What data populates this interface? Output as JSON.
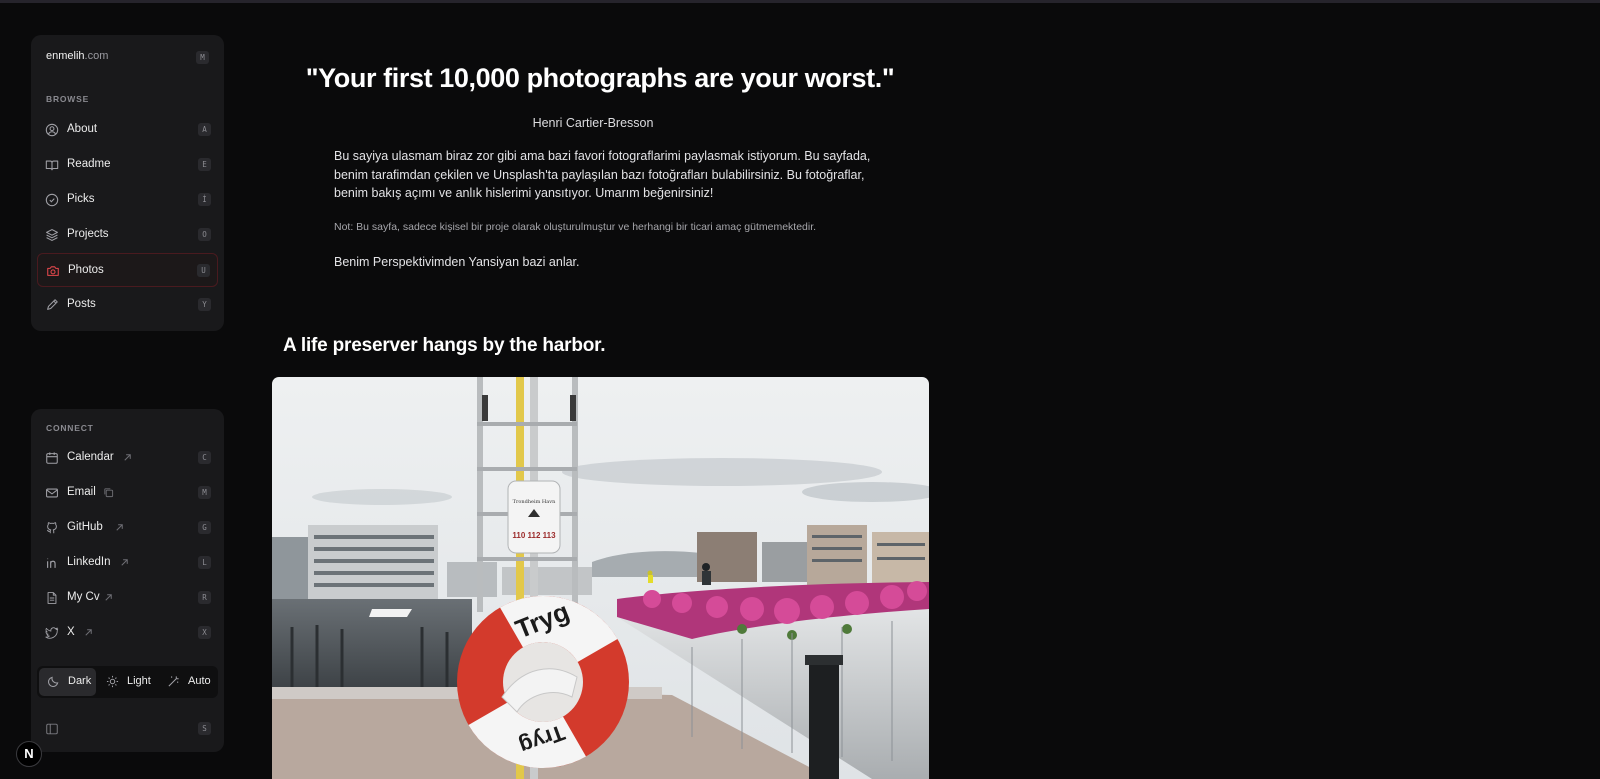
{
  "site": {
    "name": "enmelih",
    "tld": ".com",
    "key": "M"
  },
  "browse": {
    "label": "BROWSE",
    "items": [
      {
        "label": "About",
        "key": "A",
        "icon": "user-circle-icon"
      },
      {
        "label": "Readme",
        "key": "E",
        "icon": "book-open-icon"
      },
      {
        "label": "Picks",
        "key": "İ",
        "icon": "check-circle-icon"
      },
      {
        "label": "Projects",
        "key": "O",
        "icon": "layers-icon"
      },
      {
        "label": "Photos",
        "key": "U",
        "icon": "camera-icon",
        "active": true
      },
      {
        "label": "Posts",
        "key": "Y",
        "icon": "pencil-icon"
      }
    ]
  },
  "connect": {
    "label": "CONNECT",
    "items": [
      {
        "label": "Calendar",
        "key": "C",
        "icon": "calendar-icon",
        "trailing": "external-link-icon"
      },
      {
        "label": "Email",
        "key": "M",
        "icon": "mail-icon",
        "trailing": "copy-icon"
      },
      {
        "label": "GitHub",
        "key": "G",
        "icon": "github-icon",
        "trailing": "external-link-icon"
      },
      {
        "label": "LinkedIn",
        "key": "L",
        "icon": "linkedin-icon",
        "trailing": "external-link-icon"
      },
      {
        "label": "My Cv",
        "key": "R",
        "icon": "file-icon",
        "trailing": "external-link-icon"
      },
      {
        "label": "X",
        "key": "X",
        "icon": "twitter-icon",
        "trailing": "external-link-icon"
      }
    ],
    "theme": {
      "dark": "Dark",
      "light": "Light",
      "auto": "Auto",
      "selected": "Dark"
    },
    "sidebar_toggle_key": "S"
  },
  "content": {
    "quote": "\"Your first 10,000 photographs are your worst.\"",
    "author": "Henri Cartier-Bresson",
    "paragraph": "Bu sayiya ulasmam biraz zor gibi ama bazi favori fotograflarimi paylasmak istiyorum. Bu sayfada, benim tarafimdan çekilen ve Unsplash'ta paylaşılan bazı fotoğrafları bulabilirsiniz. Bu fotoğraflar, benim bakış açımı ve anlık hislerimi yansıtıyor. Umarım beğenirsiniz!",
    "note": "Not: Bu sayfa, sadece kişisel bir proje olarak oluşturulmuştur ve herhangi bir ticari amaç gütmemektedir.",
    "perspective": "Benim Perspektivimden Yansiyan bazi anlar.",
    "photo_title": "A life preserver hangs by the harbor.",
    "lifebuoy_text_top": "Tryg",
    "lifebuoy_text_bottom": "Tryg",
    "sign_text": "Trondheim Havn",
    "sign_number": "110 112 113"
  },
  "badge": "N",
  "colors": {
    "accent": "#e5484d",
    "background": "#0a0a0b",
    "panel": "#19191b"
  }
}
